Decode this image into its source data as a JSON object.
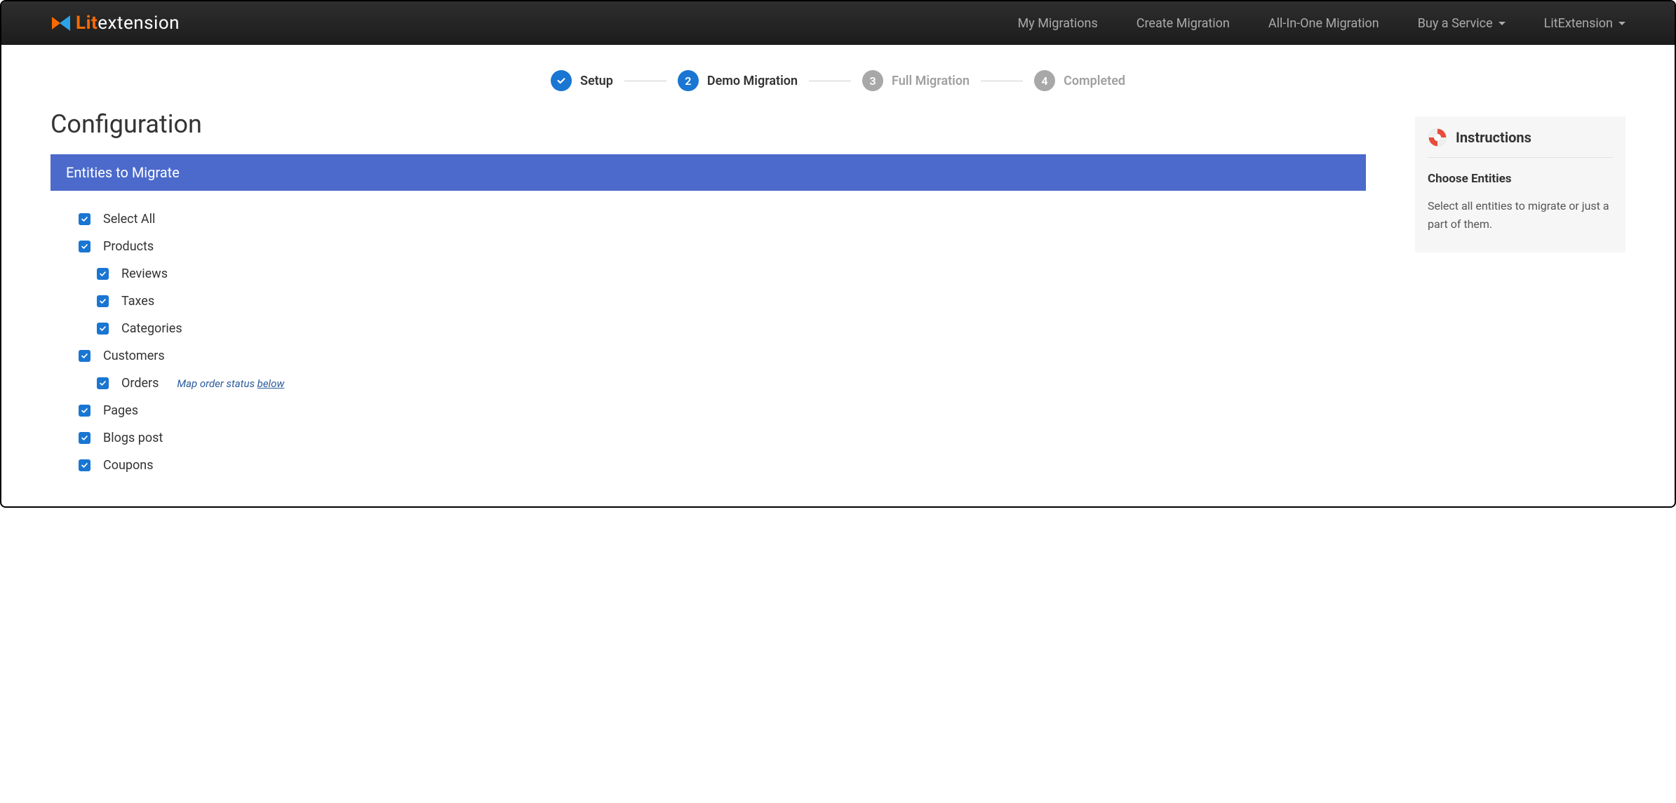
{
  "logo": {
    "prefix": "Lit",
    "suffix": "extension"
  },
  "nav": {
    "my_migrations": "My Migrations",
    "create_migration": "Create Migration",
    "all_in_one": "All-In-One Migration",
    "buy_service": "Buy a Service",
    "litextension": "LitExtension"
  },
  "stepper": {
    "setup": {
      "label": "Setup"
    },
    "demo": {
      "num": "2",
      "label": "Demo Migration"
    },
    "full": {
      "num": "3",
      "label": "Full Migration"
    },
    "completed": {
      "num": "4",
      "label": "Completed"
    }
  },
  "page": {
    "title": "Configuration",
    "panel_header": "Entities to Migrate"
  },
  "entities": {
    "select_all": "Select All",
    "products": "Products",
    "reviews": "Reviews",
    "taxes": "Taxes",
    "categories": "Categories",
    "customers": "Customers",
    "orders": "Orders",
    "orders_hint_prefix": "Map order status ",
    "orders_hint_link": "below",
    "pages": "Pages",
    "blogs": "Blogs post",
    "coupons": "Coupons"
  },
  "sidebar": {
    "title": "Instructions",
    "subtitle": "Choose Entities",
    "text": "Select all entities to migrate or just a part of them."
  }
}
